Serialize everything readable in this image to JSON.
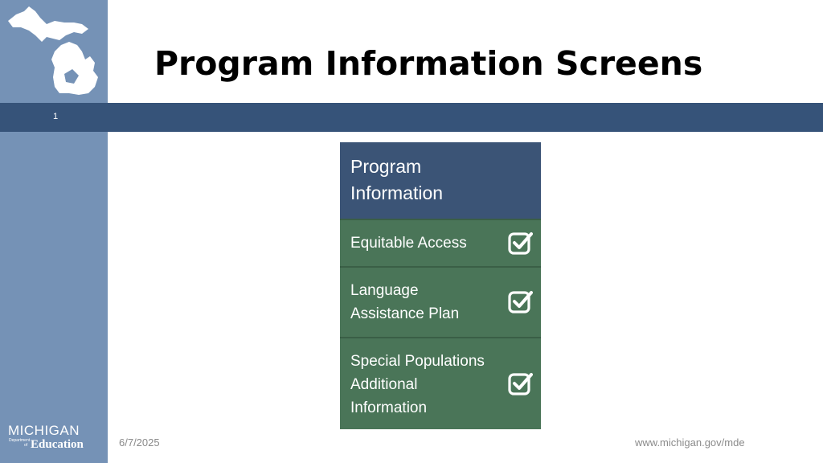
{
  "slide": {
    "title": "Program Information Screens",
    "number": "1",
    "date": "6/7/2025",
    "url": "www.michigan.gov/mde"
  },
  "logo": {
    "top_word": "MICHIGAN",
    "small_text_1": "Department",
    "small_text_2": "of",
    "bottom_word": "Education"
  },
  "panel": {
    "header_line1": "Program",
    "header_line2": "Information",
    "items": [
      {
        "lines": [
          "Equitable Access"
        ],
        "status_icon": "checkbox-checked-icon"
      },
      {
        "lines": [
          "Language",
          "Assistance Plan"
        ],
        "status_icon": "checkbox-checked-icon"
      },
      {
        "lines": [
          "Special Populations",
          "Additional",
          "Information"
        ],
        "status_icon": "checkbox-checked-icon"
      }
    ]
  },
  "colors": {
    "sidebar": "#7592b6",
    "banner": "#365379",
    "panel_header": "#3b5476",
    "panel_item": "#4a7558"
  }
}
